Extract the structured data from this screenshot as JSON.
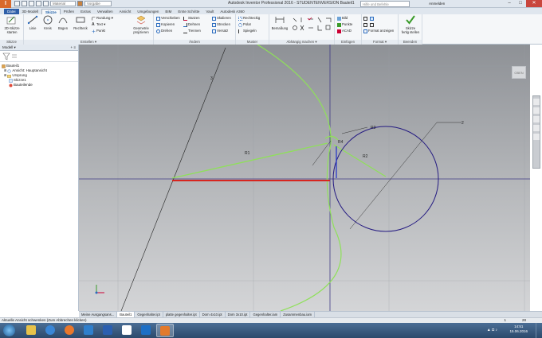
{
  "titlebar": {
    "logo": "I",
    "material_value": "Material",
    "appearance_value": "Vorgabe",
    "title": "Autodesk Inventor Professional 2016 - STUDENTENVERSION   Bauteil1",
    "help_placeholder": "Hilfe und Befehle durchsuchen...",
    "sign_in": "Anmelden",
    "min": "–",
    "max": "□",
    "close": "✕"
  },
  "tabs": [
    "3D-Modell",
    "Skizze",
    "Prüfen",
    "Extras",
    "Verwalten",
    "Ansicht",
    "Umgebungen",
    "BIM",
    "Erste Schritte",
    "Vault",
    "Autodesk A360"
  ],
  "tabs_file": "Datei",
  "tabs_active_index": 1,
  "ribbon": {
    "skizze": {
      "footer": "Skizze",
      "start_label_1": "2D-Skizze",
      "start_label_2": "starten"
    },
    "erstellen": {
      "footer": "Erstellen ▾",
      "linie": "Linie",
      "kreis": "Kreis",
      "bogen": "Bogen",
      "rechteck": "Rechteck",
      "rundung": "Rundung ▾",
      "text": "Text ▾",
      "punkt": "Punkt",
      "projizieren_1": "Geometrie",
      "projizieren_2": "projizieren"
    },
    "aendern": {
      "footer": "Ändern",
      "verschieben": "Verschieben",
      "kopieren": "Kopieren",
      "drehen": "Drehen",
      "stutzen": "Stutzen",
      "dehnen": "Dehnen",
      "trennen": "Trennen",
      "skalieren": "Skalieren",
      "strecken": "Strecken",
      "versatz": "Versatz"
    },
    "muster": {
      "footer": "Muster",
      "rechteckig": "Rechteckig",
      "polar": "Polar",
      "spiegeln": "Spiegeln"
    },
    "abhaengig": {
      "footer": "Abhängig machen ▾",
      "bemassung": "Bemaßung"
    },
    "einfuegen": {
      "footer": "Einfügen",
      "bild": "Bild",
      "punkte": "Punkte",
      "acad": "ACAD"
    },
    "format": {
      "footer": "Format ▾",
      "format_anzeigen": "Format anzeigen"
    },
    "beenden": {
      "footer": "Beenden",
      "fertig_1": "Skizze",
      "fertig_2": "fertig stellen"
    }
  },
  "browser": {
    "title": "Modell ▾",
    "items": [
      {
        "label": "Bauteil1",
        "icon": "part-icon"
      },
      {
        "label": "Ansicht: Hauptansicht",
        "icon": "view-icon"
      },
      {
        "label": "Ursprung",
        "icon": "origin-folder-icon"
      },
      {
        "label": "Skizze1",
        "icon": "sketch-icon"
      },
      {
        "label": "Bauteilende",
        "icon": "end-of-part-icon"
      }
    ]
  },
  "canvas": {
    "viewcube_label": "OBEN",
    "dim_labels": [
      "R1",
      "R2",
      "R3",
      "R4",
      "2",
      "3"
    ]
  },
  "doctabs": [
    {
      "label": "Meine Ausgangsans...",
      "active": false
    },
    {
      "label": "Bauteil1",
      "active": true
    },
    {
      "label": "Gegenhalter.ipt",
      "active": false
    },
    {
      "label": "platte gegenhalter.ipt",
      "active": false
    },
    {
      "label": "Dorn 4x10.ipt",
      "active": false
    },
    {
      "label": "Dorn 3x10.ipt",
      "active": false
    },
    {
      "label": "Gegenhalter.iam",
      "active": false
    },
    {
      "label": "Zusammenbau.iam",
      "active": false
    }
  ],
  "statusbar": {
    "message": "Aktuelle Ansicht schwenken (Zum Abbrechen klicken)",
    "num1": "1",
    "num2": "28"
  },
  "taskbar": {
    "time": "14:51",
    "date": "15.06.2016"
  },
  "colors": {
    "ribbon_accent": "#1d5fa8",
    "sketch_green": "#8fe05a",
    "circle_blue": "#241a82",
    "line_red": "#d8251e",
    "finish_green": "#3a9b2a"
  }
}
